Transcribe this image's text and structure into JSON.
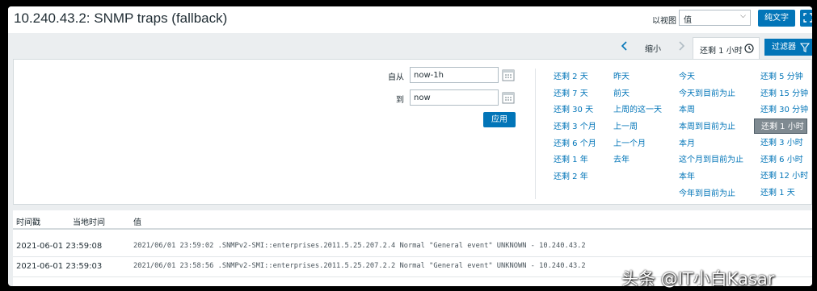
{
  "header": {
    "title": "10.240.43.2: SNMP traps (fallback)",
    "view_label": "以视图",
    "view_select_value": "值",
    "text_button": "纯文字"
  },
  "tabbar": {
    "zoom_out": "缩小",
    "time_tab": "还剩 1 小时",
    "filter_tab": "过滤器"
  },
  "filter": {
    "from_label": "自从",
    "from_value": "now-1h",
    "to_label": "到",
    "to_value": "now",
    "apply_button": "应用"
  },
  "quick_ranges": {
    "col1": [
      "还剩 2 天",
      "还剩 7 天",
      "还剩 30 天",
      "还剩 3 个月",
      "还剩 6 个月",
      "还剩 1 年",
      "还剩 2 年"
    ],
    "col2": [
      "昨天",
      "前天",
      "上周的这一天",
      "上一周",
      "上一个月",
      "去年"
    ],
    "col3": [
      "今天",
      "今天到目前为止",
      "本周",
      "本周到目前为止",
      "本月",
      "这个月到目前为止",
      "本年",
      "今年到目前为止"
    ],
    "col4": [
      "还剩 5 分钟",
      "还剩 15 分钟",
      "还剩 30 分钟",
      "还剩 1 小时",
      "还剩 3 小时",
      "还剩 6 小时",
      "还剩 12 小时",
      "还剩 1 天"
    ],
    "selected": "还剩 1 小时"
  },
  "table": {
    "headers": {
      "time": "时间戳",
      "local_time": "当地时间",
      "value": "值"
    },
    "rows": [
      {
        "time": "2021-06-01 23:59:08",
        "value": "2021/06/01 23:59:02 .SNMPv2-SMI::enterprises.2011.5.25.207.2.4 Normal \"General event\" UNKNOWN - 10.240.43.2"
      },
      {
        "time": "2021-06-01 23:59:03",
        "value": "2021/06/01 23:58:56 .SNMPv2-SMI::enterprises.2011.5.25.207.2.2 Normal \"General event\" UNKNOWN - 10.240.43.2"
      }
    ]
  },
  "watermark": "头条 @IT小白Kasar",
  "colors": {
    "accent": "#0275b8",
    "selected": "#7f8a91",
    "background": "#ebeef0"
  }
}
